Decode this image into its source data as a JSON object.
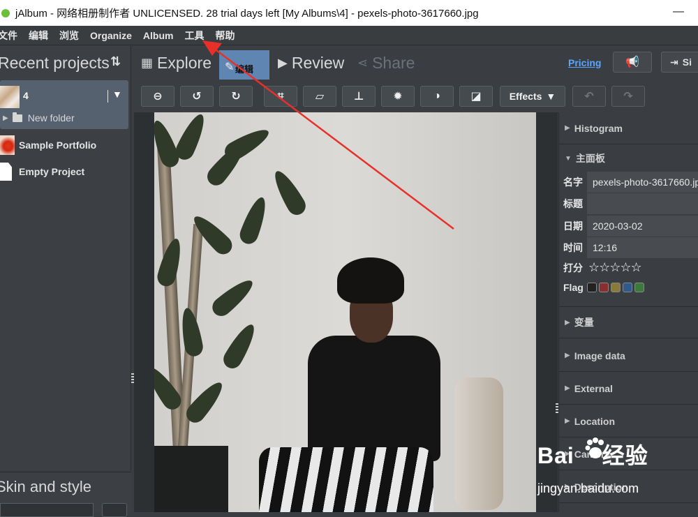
{
  "window": {
    "title": "jAlbum - 网络相册制作者 UNLICENSED. 28 trial days left [My Albums\\4] - pexels-photo-3617660.jpg",
    "minimize_glyph": "—"
  },
  "menu": [
    "文件",
    "编辑",
    "浏览",
    "Organize",
    "Album",
    "工具",
    "帮助"
  ],
  "left_panel": {
    "title": "Recent projects",
    "sort_icon": "⇅",
    "current_project": {
      "name": "4",
      "subfolder": "New folder"
    },
    "projects": [
      "Sample Portfolio",
      "Empty Project"
    ]
  },
  "skin_panel": {
    "title": "Skin and style"
  },
  "tabs": {
    "explore": "Explore",
    "edit": "编辑",
    "review": "Review",
    "share": "Share",
    "pricing": "Pricing",
    "signin_partial": "Si"
  },
  "toolbar": {
    "effects_label": "Effects"
  },
  "right_panel": {
    "histogram": "Histogram",
    "main_panel": "主面板",
    "fields": {
      "name_label": "名字",
      "name_value": "pexels-photo-3617660.jpg",
      "title_label": "标题",
      "title_value": "",
      "date_label": "日期",
      "date_value": "2020-03-02",
      "time_label": "时间",
      "time_value": "12:16",
      "rating_label": "打分",
      "rating_value": 0,
      "rating_max": 5,
      "flag_label": "Flag"
    },
    "flag_colors": [
      "#222222",
      "#8a2f2f",
      "#8a7a3a",
      "#2f5a8a",
      "#3a7a3a"
    ],
    "sections_after": [
      "变量",
      "Image data",
      "External",
      "Location",
      "Camera",
      "Description"
    ]
  },
  "watermark": {
    "brand": "Bai",
    "brand2": "经验",
    "url": "jingyan.baidu.com"
  },
  "annotation": {
    "arrow_color": "#e8302a"
  }
}
